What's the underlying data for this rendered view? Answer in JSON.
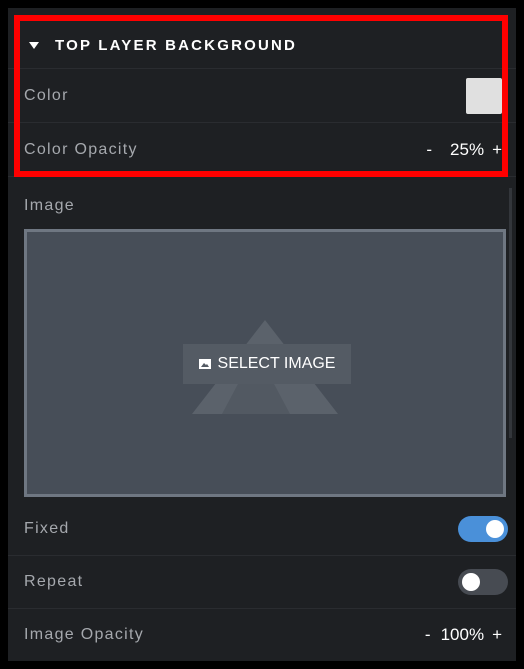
{
  "section": {
    "title": "TOP LAYER BACKGROUND"
  },
  "color_row": {
    "label": "Color",
    "swatch_color": "#e0e0e0"
  },
  "color_opacity": {
    "label": "Color Opacity",
    "minus": "-",
    "value": "25%",
    "plus": "+"
  },
  "image": {
    "label": "Image",
    "select_label": "SELECT IMAGE"
  },
  "fixed": {
    "label": "Fixed",
    "enabled": true
  },
  "repeat": {
    "label": "Repeat",
    "enabled": false
  },
  "image_opacity": {
    "label": "Image Opacity",
    "minus": "-",
    "value": "100%",
    "plus": "+"
  },
  "colors": {
    "highlight": "#ff0000",
    "toggle_on": "#4a90d9",
    "panel_bg": "#1e2023"
  }
}
